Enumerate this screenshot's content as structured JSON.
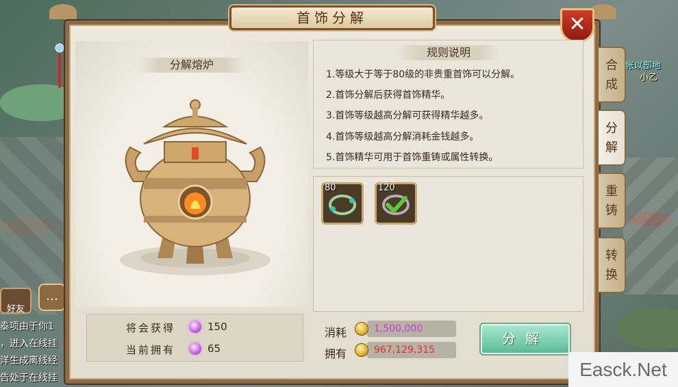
{
  "window": {
    "title": "首饰分解",
    "close_label": "✕"
  },
  "furnace": {
    "title": "分解熔炉"
  },
  "rules": {
    "title": "规则说明",
    "items": [
      "1.等级大于等于80级的非贵重首饰可以分解。",
      "2.首饰分解后获得首饰精华。",
      "3.首饰等级越高分解可获得精华越多。",
      "4.首饰等级越高分解消耗金钱越多。",
      "5.首饰精华可用于首饰重铸或属性转换。"
    ]
  },
  "items": [
    {
      "level": "80",
      "icon": "bracelet-icon",
      "checked": false
    },
    {
      "level": "120",
      "icon": "bracelet-checked-icon",
      "checked": true
    }
  ],
  "stats": {
    "will_get_label": "将会获得",
    "will_get_value": "150",
    "owned_label": "当前拥有",
    "owned_value": "65"
  },
  "cost": {
    "consume_label": "消耗",
    "consume_value": "1,500,000",
    "consume_color": "#c43ad0",
    "own_label": "拥有",
    "own_value": "967,129,315",
    "own_color": "#e0302a"
  },
  "decompose_button": "分解",
  "tabs": [
    {
      "label_1": "合",
      "label_2": "成",
      "active": false
    },
    {
      "label_1": "分",
      "label_2": "解",
      "active": true
    },
    {
      "label_1": "重",
      "label_2": "铸",
      "active": false
    },
    {
      "label_1": "转",
      "label_2": "换",
      "active": false
    }
  ],
  "background": {
    "chat_lines": [
      "泰项由于你1",
      "，进入在线挂",
      "洋生成离线经",
      "告处于在线挂"
    ],
    "friend_label": "好友",
    "npc_name_1": "帐以部地",
    "npc_name_2": "小乙"
  },
  "watermark": "Easck.Net"
}
